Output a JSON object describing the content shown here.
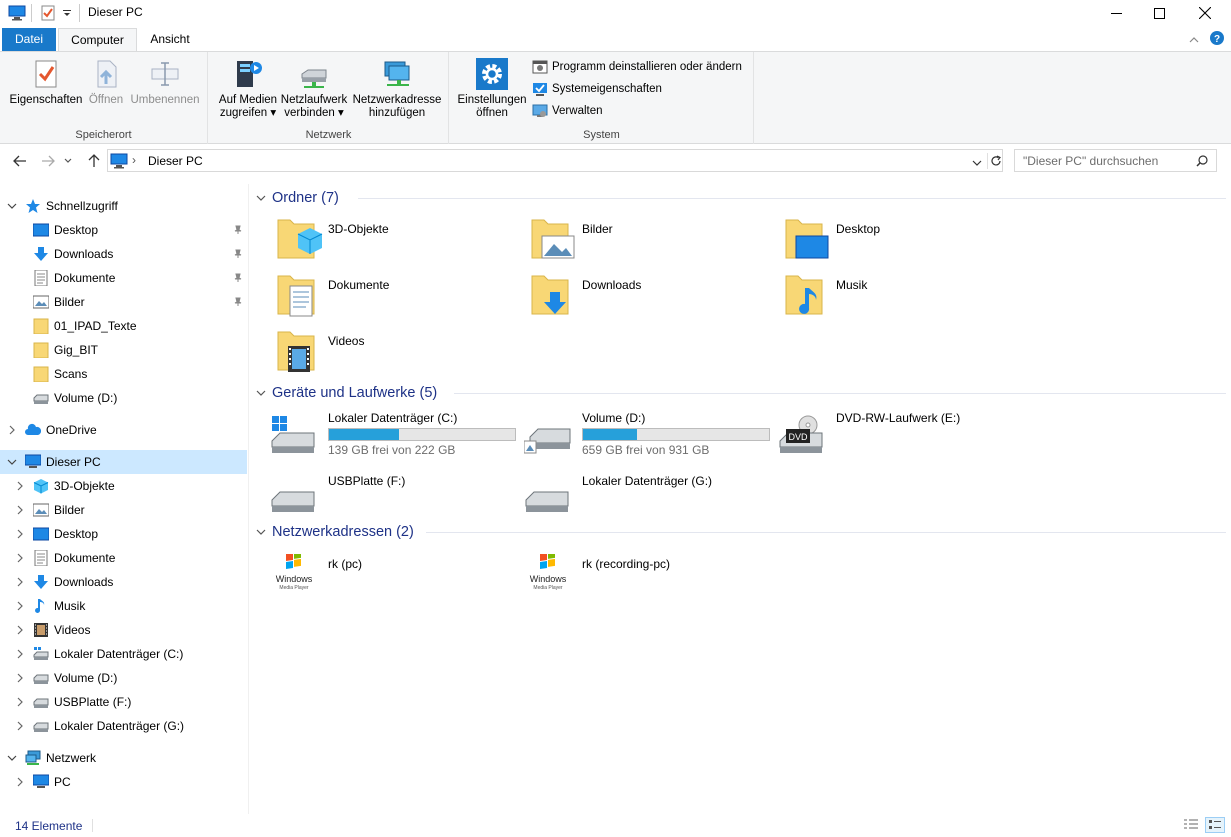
{
  "window": {
    "title": "Dieser PC",
    "minimize_icon": "minimize-icon",
    "maximize_icon": "maximize-icon",
    "close_icon": "close-icon"
  },
  "ribbon_tabs": {
    "file": "Datei",
    "computer": "Computer",
    "view": "Ansicht"
  },
  "ribbon": {
    "location_group": {
      "label": "Speicherort",
      "properties": "Eigenschaften",
      "open": "Öffnen",
      "rename": "Umbenennen"
    },
    "network_group": {
      "label": "Netzwerk",
      "media_line1": "Auf Medien",
      "media_line2": "zugreifen ▾",
      "map_line1": "Netzlaufwerk",
      "map_line2": "verbinden ▾",
      "add_line1": "Netzwerkadresse",
      "add_line2": "hinzufügen"
    },
    "system_group": {
      "label": "System",
      "settings_line1": "Einstellungen",
      "settings_line2": "öffnen",
      "uninstall": "Programm deinstallieren oder ändern",
      "sysprops": "Systemeigenschaften",
      "manage": "Verwalten"
    }
  },
  "address": {
    "separator": "›",
    "location": "Dieser PC",
    "search_placeholder": "\"Dieser PC\" durchsuchen"
  },
  "navpane": {
    "quick_access": "Schnellzugriff",
    "quick_items": [
      {
        "label": "Desktop",
        "pinned": true
      },
      {
        "label": "Downloads",
        "pinned": true
      },
      {
        "label": "Dokumente",
        "pinned": true
      },
      {
        "label": "Bilder",
        "pinned": true
      },
      {
        "label": "01_IPAD_Texte",
        "pinned": false
      },
      {
        "label": "Gig_BIT",
        "pinned": false
      },
      {
        "label": "Scans",
        "pinned": false
      },
      {
        "label": "Volume (D:)",
        "pinned": false
      }
    ],
    "onedrive": "OneDrive",
    "this_pc": "Dieser PC",
    "pc_items": [
      "3D-Objekte",
      "Bilder",
      "Desktop",
      "Dokumente",
      "Downloads",
      "Musik",
      "Videos",
      "Lokaler Datenträger (C:)",
      "Volume (D:)",
      "USBPlatte (F:)",
      "Lokaler Datenträger (G:)"
    ],
    "network": "Netzwerk",
    "network_items": [
      "PC"
    ]
  },
  "content": {
    "folders_header": "Ordner (7)",
    "folders": [
      "3D-Objekte",
      "Bilder",
      "Desktop",
      "Dokumente",
      "Downloads",
      "Musik",
      "Videos"
    ],
    "drives_header": "Geräte und Laufwerke (5)",
    "drives": [
      {
        "label": "Lokaler Datenträger (C:)",
        "free": "139 GB frei von 222 GB",
        "used_fraction": 0.374
      },
      {
        "label": "Volume (D:)",
        "free": "659 GB frei von 931 GB",
        "used_fraction": 0.292
      },
      {
        "label": "DVD-RW-Laufwerk (E:)",
        "dvd_badge": "DVD"
      },
      {
        "label": "USBPlatte (F:)"
      },
      {
        "label": "Lokaler Datenträger (G:)"
      }
    ],
    "network_header": "Netzwerkadressen (2)",
    "network_locations": [
      {
        "label": "rk (pc)",
        "logo_line1": "Windows",
        "logo_line2": "Media Player"
      },
      {
        "label": "rk (recording-pc)",
        "logo_line1": "Windows",
        "logo_line2": "Media Player"
      }
    ]
  },
  "status": {
    "count": "14 Elemente"
  },
  "colors": {
    "accent": "#1979ca",
    "selection": "#cce8ff",
    "header_text": "#1e3287",
    "bar_fill": "#26a0da",
    "folder": "#f8d775"
  }
}
